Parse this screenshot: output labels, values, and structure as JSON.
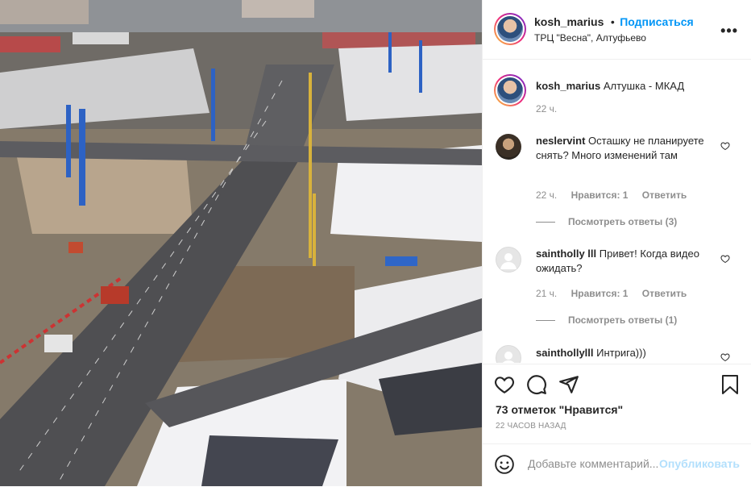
{
  "post": {
    "username": "kosh_marius",
    "follow_label": "Подписаться",
    "separator": "•",
    "location": "ТРЦ \"Весна\", Алтуфьево",
    "more_label": "•••"
  },
  "caption": {
    "username": "kosh_marius",
    "text": "Алтушка - МКАД",
    "time": "22 ч."
  },
  "comments": [
    {
      "username": "neslervint",
      "text": "Осташку не планируете снять? Много изменений там",
      "time": "22 ч.",
      "likes": "Нравится: 1",
      "reply": "Ответить",
      "view_replies": "Посмотреть ответы (3)"
    },
    {
      "username": "saintholly lll",
      "text": "Привет! Когда видео ожидать?",
      "time": "21 ч.",
      "likes": "Нравится: 1",
      "reply": "Ответить",
      "view_replies": "Посмотреть ответы (1)"
    },
    {
      "username": "sainthollylll",
      "text": "Интрига)))"
    }
  ],
  "actions": {
    "likes_count": "73 отметок \"Нравится\"",
    "timestamp": "22 ЧАСОВ НАЗАД"
  },
  "add_comment": {
    "placeholder": "Добавьте комментарий...",
    "publish_label": "Опубликовать"
  }
}
